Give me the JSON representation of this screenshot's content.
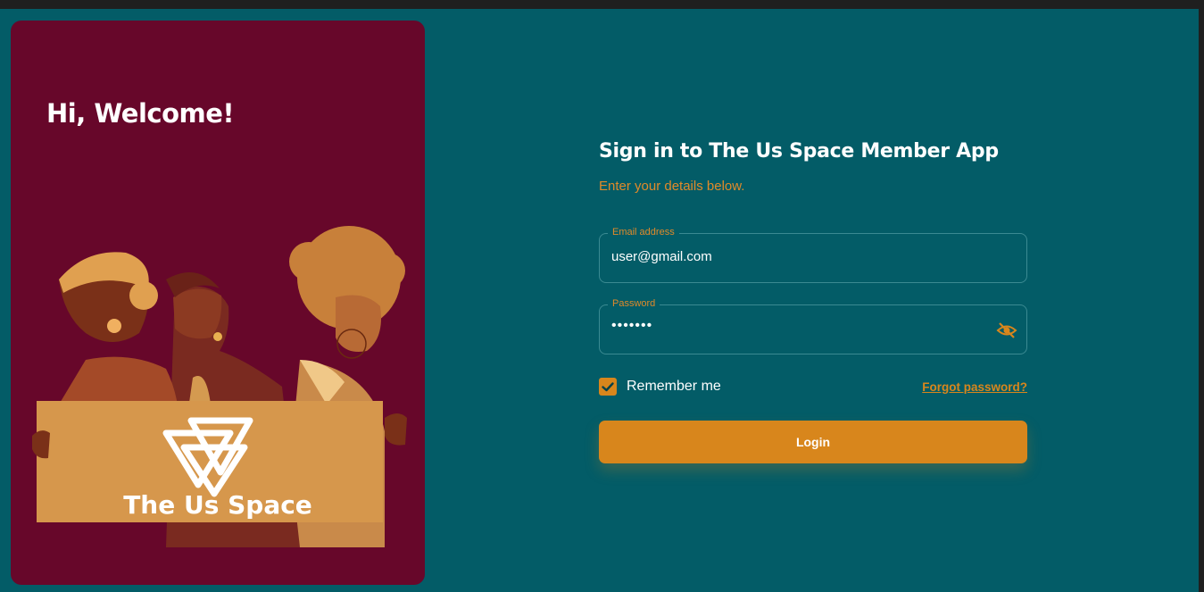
{
  "welcome": {
    "heading": "Hi, Welcome!"
  },
  "illustration": {
    "logo_text": "The Us Space"
  },
  "form": {
    "title": "Sign in to The Us Space Member App",
    "subtitle": "Enter your details below.",
    "email": {
      "label": "Email address",
      "value": "user@gmail.com"
    },
    "password": {
      "label": "Password",
      "value": "•••••••",
      "icon": "eye-off-icon"
    },
    "remember_label": "Remember me",
    "remember_checked": true,
    "forgot_label": "Forgot password?",
    "login_label": "Login"
  },
  "colors": {
    "background": "#035c67",
    "card": "#67072a",
    "accent": "#d8861c",
    "accent_text": "#e08a2a"
  }
}
